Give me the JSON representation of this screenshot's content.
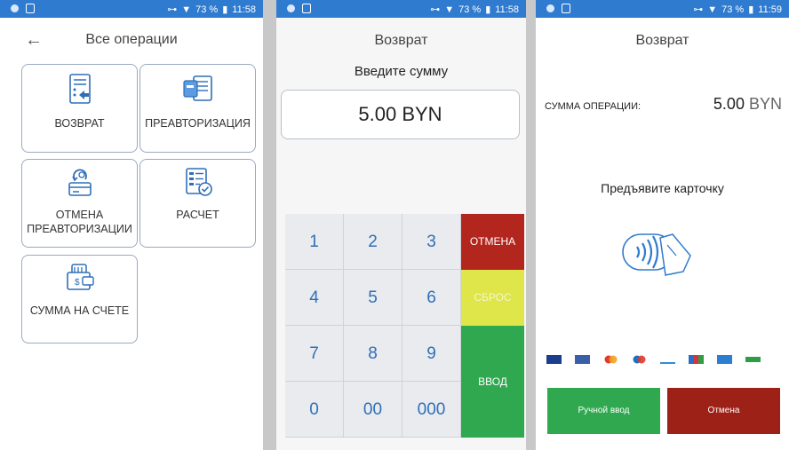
{
  "status_bar": {
    "screen1": {
      "battery": "73 %",
      "time": "11:58"
    },
    "screen2": {
      "battery": "73 %",
      "time": "11:58"
    },
    "screen3": {
      "battery": "73 %",
      "time": "11:59"
    }
  },
  "screen1": {
    "title": "Все операции",
    "tiles": [
      {
        "label": "ВОЗВРАТ",
        "icon": "refund-document-icon"
      },
      {
        "label": "ПРЕАВТОРИЗАЦИЯ",
        "icon": "preauth-card-icon"
      },
      {
        "label_line1": "ОТМЕНА",
        "label_line2": "ПРЕАВТОРИЗАЦИИ",
        "icon": "cancel-preauth-icon"
      },
      {
        "label": "РАСЧЕТ",
        "icon": "settlement-checklist-icon"
      },
      {
        "label": "СУММА НА СЧЕТЕ",
        "icon": "account-balance-icon"
      }
    ]
  },
  "screen2": {
    "title": "Возврат",
    "prompt": "Введите сумму",
    "amount": "5.00 BYN",
    "keys": [
      "1",
      "2",
      "3",
      "4",
      "5",
      "6",
      "7",
      "8",
      "9",
      "0",
      "00",
      "000"
    ],
    "cancel_label": "ОТМЕНА",
    "reset_label": "СБРОС",
    "enter_label": "ВВОД"
  },
  "screen3": {
    "title": "Возврат",
    "sum_label": "СУММА ОПЕРАЦИИ:",
    "sum_value": "5.00",
    "currency": "BYN",
    "present_card": "Предъявите карточку",
    "manual_button": "Ручной ввод",
    "cancel_button": "Отмена"
  },
  "colors": {
    "status_bar": "#2f7bd0",
    "cancel_red": "#b3261e",
    "reset_yellow": "#dfe64a",
    "enter_green": "#2fa84f",
    "key_gray": "#e9ebee",
    "key_text": "#2f6fb8",
    "cancel_button": "#9e2118",
    "manual_button": "#2fa84f"
  }
}
